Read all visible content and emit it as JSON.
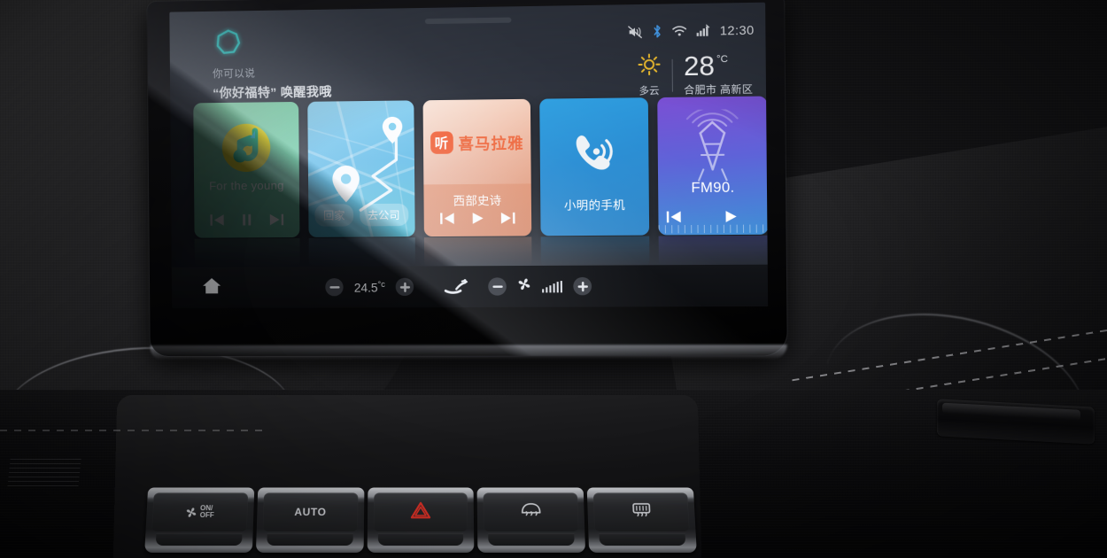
{
  "status_bar": {
    "icons": [
      "volume-muted-icon",
      "bluetooth-icon",
      "wifi-icon",
      "cellular-signal-icon"
    ],
    "clock": "12:30"
  },
  "assistant": {
    "orb_icon": "voice-assistant-orb-icon",
    "prompt_label": "你可以说",
    "wake_phrase": "“你好福特” 唤醒我哦"
  },
  "weather": {
    "icon": "sun-icon",
    "condition": "多云",
    "temperature": "28",
    "degree_symbol": "°",
    "unit": "C",
    "location": "合肥市 高新区"
  },
  "cards": [
    {
      "name": "music",
      "app_icon": "qq-music-note-icon",
      "title": "For the young",
      "controls": [
        {
          "name": "previous-track-button",
          "icon": "skip-previous-icon"
        },
        {
          "name": "pause-button",
          "icon": "pause-icon"
        },
        {
          "name": "next-track-button",
          "icon": "skip-next-icon"
        }
      ],
      "accent": "#75d2aa"
    },
    {
      "name": "navigation",
      "app_icon": "map-route-icon",
      "buttons": [
        {
          "name": "go-home-button",
          "label": "回家"
        },
        {
          "name": "go-to-office-button",
          "label": "去公司"
        }
      ],
      "accent": "#62bde9"
    },
    {
      "name": "podcast",
      "brand_badge": "听",
      "brand_name": "喜马拉雅",
      "title": "西部史诗",
      "controls": [
        {
          "name": "previous-episode-button",
          "icon": "skip-previous-icon"
        },
        {
          "name": "play-button",
          "icon": "play-icon"
        },
        {
          "name": "next-episode-button",
          "icon": "skip-next-icon"
        }
      ],
      "accent": "#e8a183"
    },
    {
      "name": "phone",
      "app_icon": "phone-call-icon",
      "title": "小明的手机",
      "accent": "#2a8ed4"
    },
    {
      "name": "radio",
      "app_icon": "radio-tower-icon",
      "title": "FM90.",
      "controls": [
        {
          "name": "previous-station-button",
          "icon": "skip-previous-icon"
        },
        {
          "name": "play-station-button",
          "icon": "play-icon"
        }
      ],
      "accent": "#5e63d8"
    }
  ],
  "toolbar": {
    "home_icon": "home-icon",
    "temperature": {
      "decrease_icon": "minus-icon",
      "value": "24.5",
      "degree": "°",
      "unit": "c",
      "increase_icon": "plus-icon"
    },
    "airflow_icon": "seat-airflow-icon",
    "fan": {
      "decrease_icon": "minus-icon",
      "icon": "fan-icon",
      "level_bars": 6,
      "increase_icon": "plus-icon"
    }
  },
  "hvac_buttons": [
    {
      "name": "fan-on-off-button",
      "icon": "fan-icon",
      "line1": "ON/",
      "line2": "OFF"
    },
    {
      "name": "auto-climate-button",
      "label": "AUTO"
    },
    {
      "name": "hazard-lights-button",
      "icon": "hazard-triangle-icon",
      "color": "#e8352a"
    },
    {
      "name": "front-defrost-button",
      "icon": "front-defrost-icon"
    },
    {
      "name": "rear-defrost-button",
      "icon": "rear-defrost-icon"
    }
  ]
}
